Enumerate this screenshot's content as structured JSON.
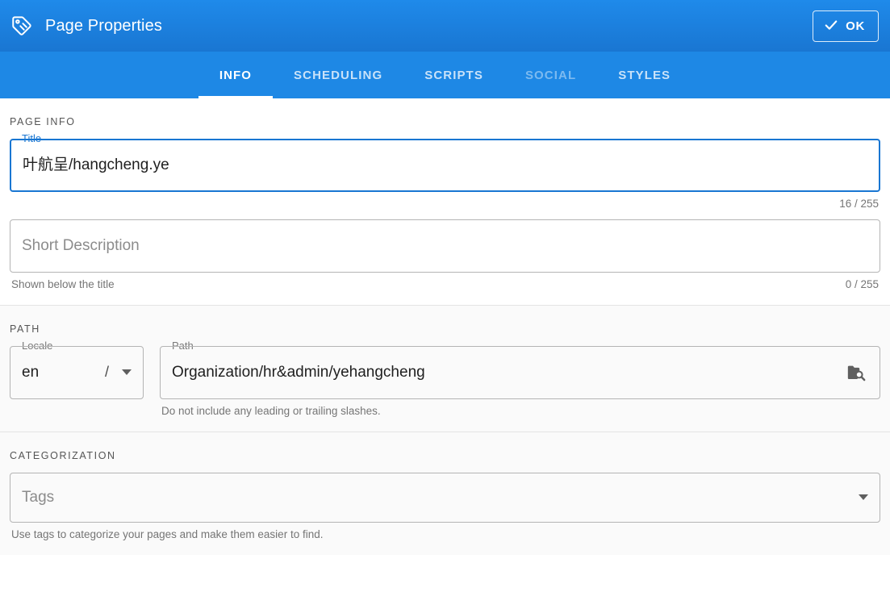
{
  "header": {
    "icon": "tag-icon",
    "title": "Page Properties",
    "ok_label": "OK",
    "ok_icon": "check-icon",
    "brand_color": "#1976d2",
    "tabbar_color": "#1e88e5"
  },
  "tabs": [
    {
      "label": "INFO",
      "state": "active"
    },
    {
      "label": "SCHEDULING",
      "state": "normal"
    },
    {
      "label": "SCRIPTS",
      "state": "normal"
    },
    {
      "label": "SOCIAL",
      "state": "disabled"
    },
    {
      "label": "STYLES",
      "state": "normal"
    }
  ],
  "page_info": {
    "section_title": "PAGE INFO",
    "title_field": {
      "label": "Title",
      "value": "叶航呈/hangcheng.ye",
      "counter": "16 / 255",
      "focused": true
    },
    "description_field": {
      "label": "Short Description",
      "placeholder": "Short Description",
      "value": "",
      "helper": "Shown below the title",
      "counter": "0 / 255"
    }
  },
  "path": {
    "section_title": "PATH",
    "locale_field": {
      "label": "Locale",
      "value": "en",
      "separator": "/",
      "dropdown_icon": "chevron-down-icon"
    },
    "path_field": {
      "label": "Path",
      "value": "Organization/hr&admin/yehangcheng",
      "helper": "Do not include any leading or trailing slashes.",
      "browse_icon": "folder-search-icon"
    }
  },
  "categorization": {
    "section_title": "CATEGORIZATION",
    "tags_field": {
      "placeholder": "Tags",
      "value": "",
      "helper": "Use tags to categorize your pages and make them easier to find.",
      "dropdown_icon": "chevron-down-icon"
    }
  }
}
